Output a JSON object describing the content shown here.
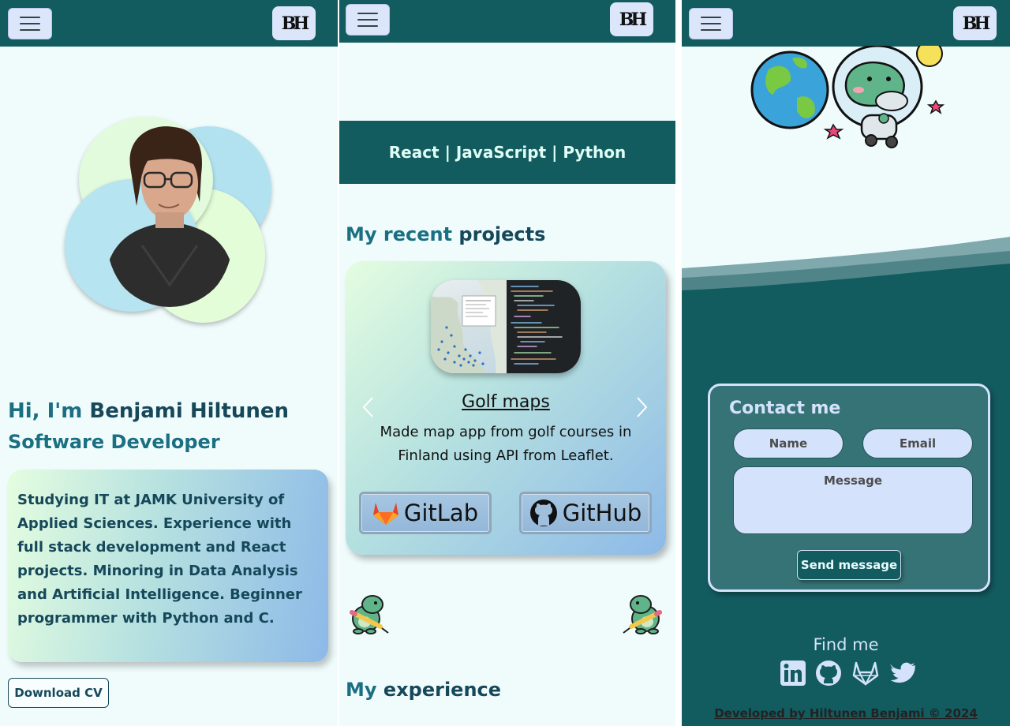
{
  "brand": {
    "logo_text": "BH"
  },
  "hero": {
    "greeting": "Hi, I'm ",
    "name": "Benjami Hiltunen",
    "role": "Software Developer",
    "about": "Studying IT at JAMK University of Applied Sciences. Experience with full stack development and React projects. Minoring in Data Analysis and Artificial Intelligence. Beginner programmer with Python and C.",
    "cv_button": "Download CV"
  },
  "skills": {
    "text": "React | JavaScript | Python"
  },
  "projects": {
    "title_accent": "My recent ",
    "title_rest": "projects",
    "items": [
      {
        "name": "Golf maps",
        "description": "Made map app from golf courses in Finland using API from Leaflet."
      }
    ],
    "gitlab_label": "GitLab",
    "github_label": "GitHub"
  },
  "experience": {
    "title_accent": "My ",
    "title_rest": "experience"
  },
  "contact": {
    "title": "Contact me",
    "name_placeholder": "Name",
    "email_placeholder": "Email",
    "message_placeholder": "Message",
    "send_button": "Send message"
  },
  "find_me": {
    "title": "Find me",
    "links": [
      "linkedin-icon",
      "github-icon",
      "gitlab-icon",
      "twitter-icon"
    ]
  },
  "footer": {
    "text": "Developed by Hiltunen Benjami © 2024"
  },
  "colors": {
    "navbar": "#125b5f",
    "accent": "#1b6f82",
    "heading_dark": "#16485a",
    "background": "#f0fcfc",
    "button_light": "#dbe6fb"
  }
}
